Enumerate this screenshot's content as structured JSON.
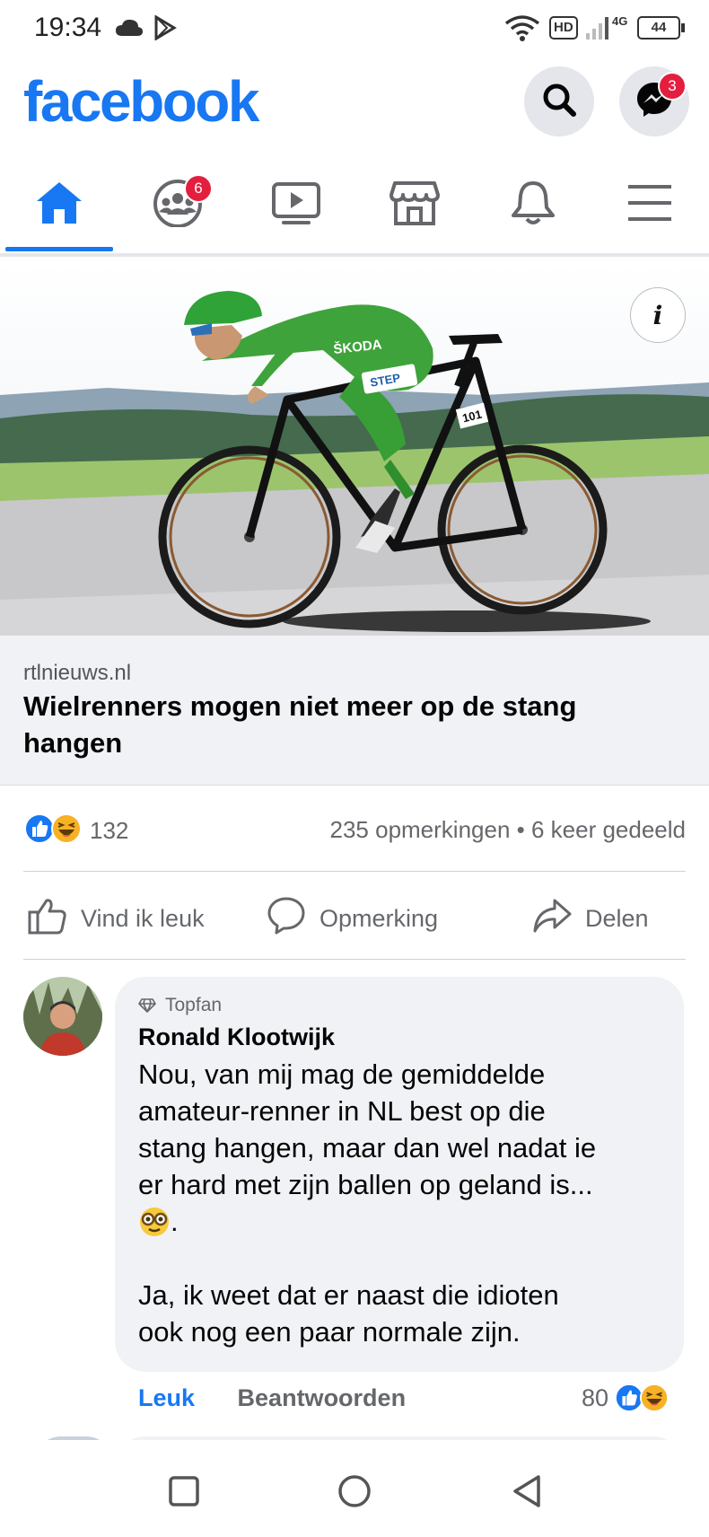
{
  "status_bar": {
    "time": "19:34",
    "network_label": "4G",
    "hd_label": "HD",
    "battery": "44",
    "icons": [
      "cloud-icon",
      "play-store-icon",
      "wifi-icon",
      "hd-icon",
      "signal-icon",
      "battery-icon"
    ]
  },
  "header": {
    "logo": "facebook",
    "search_icon": "search-icon",
    "messenger_badge": "3"
  },
  "tabs": [
    {
      "name": "home",
      "icon": "home-icon",
      "active": true
    },
    {
      "name": "groups",
      "icon": "groups-icon",
      "badge": "6"
    },
    {
      "name": "watch",
      "icon": "watch-icon"
    },
    {
      "name": "marketplace",
      "icon": "marketplace-icon"
    },
    {
      "name": "notifications",
      "icon": "bell-icon"
    },
    {
      "name": "menu",
      "icon": "menu-icon"
    }
  ],
  "post": {
    "link_domain": "rtlnieuws.nl",
    "link_title": "Wielrenners mogen niet meer op de stang hangen",
    "reaction_count": "132",
    "comments_shares": "235 opmerkingen • 6 keer gedeeld",
    "actions": {
      "like": "Vind ik leuk",
      "comment": "Opmerking",
      "share": "Delen"
    }
  },
  "comment": {
    "badge": "Topfan",
    "author": "Ronald Klootwijk",
    "lines": [
      "Nou, van mij mag de gemiddelde",
      "amateur-renner in NL best op die",
      "stang hangen, maar dan wel nadat ie",
      "er hard met zijn ballen op geland is...",
      ".",
      "",
      "Ja, ik weet dat er naast die idioten",
      "ook nog een paar normale zijn."
    ],
    "like_label": "Leuk",
    "reply_label": "Beantwoorden",
    "reaction_count": "80"
  },
  "colors": {
    "brand": "#1877f2",
    "badge": "#e41e3f",
    "secondary_text": "#65676b",
    "bubble": "#f0f2f5"
  }
}
